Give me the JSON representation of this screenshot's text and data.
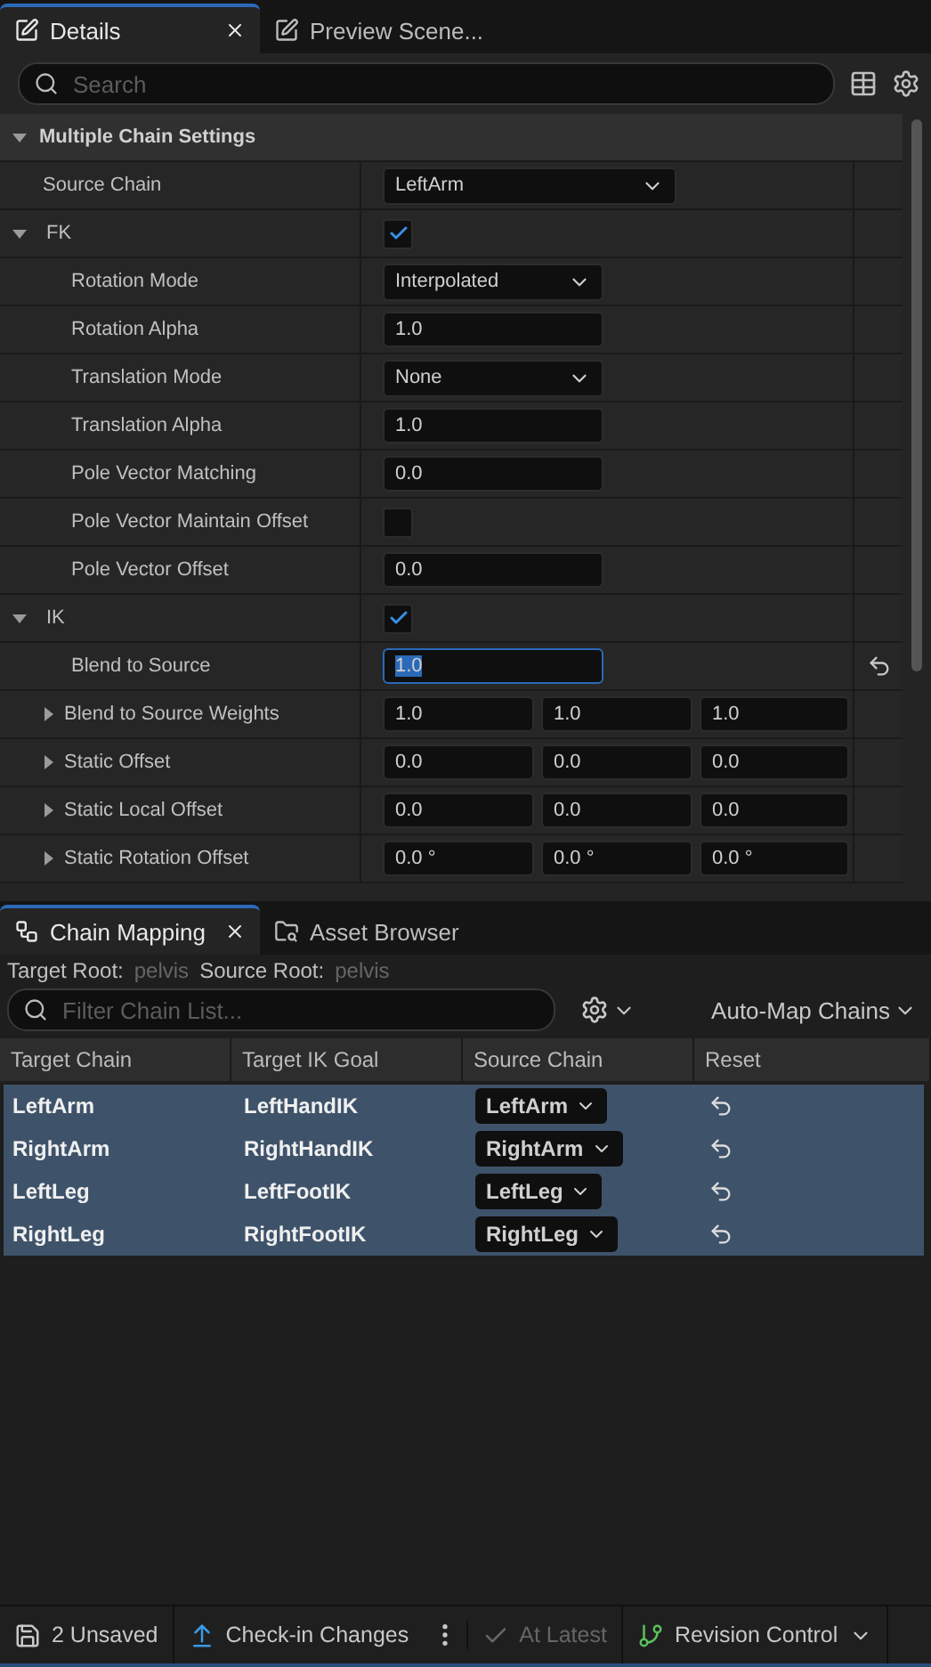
{
  "details": {
    "tabs": [
      {
        "label": "Details",
        "selected": true,
        "closable": true
      },
      {
        "label": "Preview Scene...",
        "selected": false,
        "closable": false
      }
    ],
    "search": {
      "placeholder": "Search"
    },
    "sections": [
      {
        "title": "Multiple Chain Settings",
        "expanded": true,
        "properties": [
          {
            "kind": "dropdown",
            "name": "Source Chain",
            "value": "LeftArm",
            "wide": true
          },
          {
            "kind": "group",
            "name": "FK",
            "checked": true,
            "expanded": true,
            "children": [
              {
                "kind": "dropdown",
                "name": "Rotation Mode",
                "value": "Interpolated"
              },
              {
                "kind": "number",
                "name": "Rotation Alpha",
                "value": "1.0"
              },
              {
                "kind": "dropdown",
                "name": "Translation Mode",
                "value": "None"
              },
              {
                "kind": "number",
                "name": "Translation Alpha",
                "value": "1.0"
              },
              {
                "kind": "number",
                "name": "Pole Vector Matching",
                "value": "0.0"
              },
              {
                "kind": "checkbox",
                "name": "Pole Vector Maintain Offset",
                "checked": false
              },
              {
                "kind": "number",
                "name": "Pole Vector Offset",
                "value": "0.0"
              }
            ]
          },
          {
            "kind": "group",
            "name": "IK",
            "checked": true,
            "expanded": true,
            "children": [
              {
                "kind": "number",
                "name": "Blend to Source",
                "value": "1.0",
                "focused": true,
                "resettable": true
              },
              {
                "kind": "vector",
                "name": "Blend to Source Weights",
                "expanded": false,
                "values": [
                  "1.0",
                  "1.0",
                  "1.0"
                ]
              },
              {
                "kind": "vector",
                "name": "Static Offset",
                "expanded": false,
                "values": [
                  "0.0",
                  "0.0",
                  "0.0"
                ]
              },
              {
                "kind": "vector",
                "name": "Static Local Offset",
                "expanded": false,
                "values": [
                  "0.0",
                  "0.0",
                  "0.0"
                ]
              },
              {
                "kind": "vector",
                "name": "Static Rotation Offset",
                "expanded": false,
                "values": [
                  "0.0 °",
                  "0.0 °",
                  "0.0 °"
                ]
              }
            ]
          }
        ]
      }
    ]
  },
  "chain_mapping": {
    "tabs": [
      {
        "label": "Chain Mapping",
        "selected": true,
        "closable": true
      },
      {
        "label": "Asset Browser",
        "selected": false,
        "closable": false
      }
    ],
    "roots": [
      {
        "label": "Target Root:",
        "value": "pelvis"
      },
      {
        "label": "Source Root:",
        "value": "pelvis"
      }
    ],
    "filter": {
      "placeholder": "Filter Chain List..."
    },
    "auto_map_button": "Auto-Map Chains",
    "columns": [
      "Target Chain",
      "Target IK Goal",
      "Source Chain",
      "Reset"
    ],
    "rows": [
      {
        "target_chain": "LeftArm",
        "target_ik_goal": "LeftHandIK",
        "source_chain": "LeftArm",
        "selected": true
      },
      {
        "target_chain": "RightArm",
        "target_ik_goal": "RightHandIK",
        "source_chain": "RightArm",
        "selected": true
      },
      {
        "target_chain": "LeftLeg",
        "target_ik_goal": "LeftFootIK",
        "source_chain": "LeftLeg",
        "selected": true
      },
      {
        "target_chain": "RightLeg",
        "target_ik_goal": "RightFootIK",
        "source_chain": "RightLeg",
        "selected": true
      }
    ]
  },
  "status_bar": [
    {
      "kind": "unsaved",
      "label": "2 Unsaved",
      "disabled": false
    },
    {
      "kind": "checkin",
      "label": "Check-in Changes",
      "disabled": false
    },
    {
      "kind": "more"
    },
    {
      "kind": "latest",
      "label": "At Latest",
      "disabled": true
    },
    {
      "kind": "revision",
      "label": "Revision Control",
      "disabled": false
    }
  ]
}
